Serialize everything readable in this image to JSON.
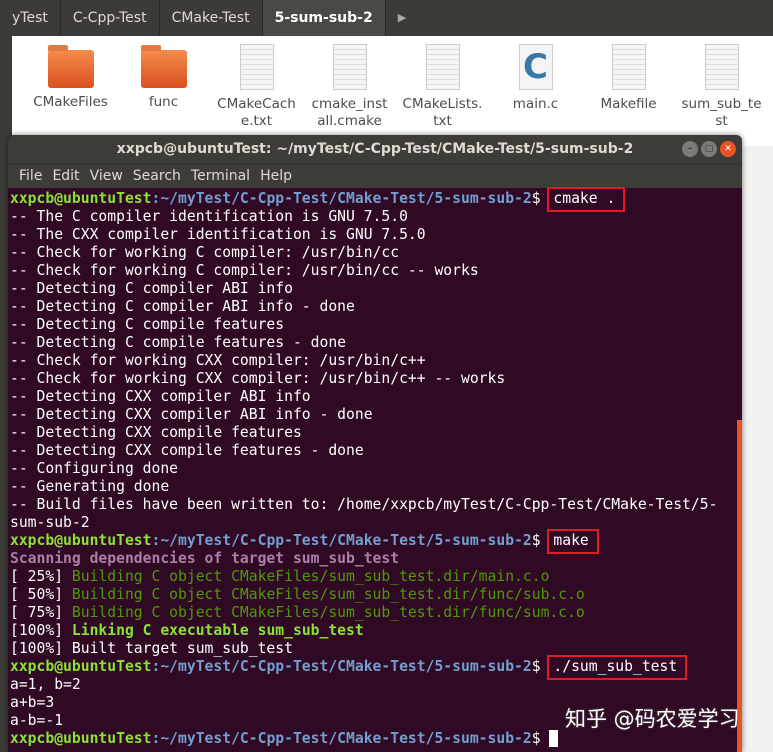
{
  "breadcrumbs": [
    "yTest",
    "C-Cpp-Test",
    "CMake-Test",
    "5-sum-sub-2"
  ],
  "files": [
    {
      "name": "CMakeFiles",
      "icon": "folder-icon"
    },
    {
      "name": "func",
      "icon": "folder-icon"
    },
    {
      "name": "CMakeCache.txt",
      "icon": "text-file-icon"
    },
    {
      "name": "cmake_install.cmake",
      "icon": "text-file-icon"
    },
    {
      "name": "CMakeLists.txt",
      "icon": "text-file-icon"
    },
    {
      "name": "main.c",
      "icon": "c-source-icon"
    },
    {
      "name": "Makefile",
      "icon": "text-file-icon"
    },
    {
      "name": "sum_sub_test",
      "icon": "text-file-icon"
    }
  ],
  "terminal": {
    "title": "xxpcb@ubuntuTest: ~/myTest/C-Cpp-Test/CMake-Test/5-sum-sub-2",
    "menu": [
      "File",
      "Edit",
      "View",
      "Search",
      "Terminal",
      "Help"
    ],
    "prompt_user": "xxpcb@ubuntuTest",
    "prompt_path": ":~/myTest/C-Cpp-Test/CMake-Test/5-sum-sub-2",
    "prompt_end": "$ ",
    "cmd1": "cmake .",
    "cmake_output": [
      "-- The C compiler identification is GNU 7.5.0",
      "-- The CXX compiler identification is GNU 7.5.0",
      "-- Check for working C compiler: /usr/bin/cc",
      "-- Check for working C compiler: /usr/bin/cc -- works",
      "-- Detecting C compiler ABI info",
      "-- Detecting C compiler ABI info - done",
      "-- Detecting C compile features",
      "-- Detecting C compile features - done",
      "-- Check for working CXX compiler: /usr/bin/c++",
      "-- Check for working CXX compiler: /usr/bin/c++ -- works",
      "-- Detecting CXX compiler ABI info",
      "-- Detecting CXX compiler ABI info - done",
      "-- Detecting CXX compile features",
      "-- Detecting CXX compile features - done",
      "-- Configuring done",
      "-- Generating done",
      "-- Build files have been written to: /home/xxpcb/myTest/C-Cpp-Test/CMake-Test/5-",
      "sum-sub-2"
    ],
    "cmd2": "make",
    "scan": "Scanning dependencies of target sum_sub_test",
    "build": [
      {
        "pct": "[ 25%] ",
        "text": "Building C object CMakeFiles/sum_sub_test.dir/main.c.o"
      },
      {
        "pct": "[ 50%] ",
        "text": "Building C object CMakeFiles/sum_sub_test.dir/func/sub.c.o"
      },
      {
        "pct": "[ 75%] ",
        "text": "Building C object CMakeFiles/sum_sub_test.dir/func/sum.c.o"
      }
    ],
    "link_pct": "[100%] ",
    "link_text": "Linking C executable sum_sub_test",
    "built": "[100%] Built target sum_sub_test",
    "cmd3": "./sum_sub_test",
    "run_output": [
      "a=1, b=2",
      "a+b=3",
      "a-b=-1"
    ]
  },
  "watermark": "知乎 @码农爱学习"
}
